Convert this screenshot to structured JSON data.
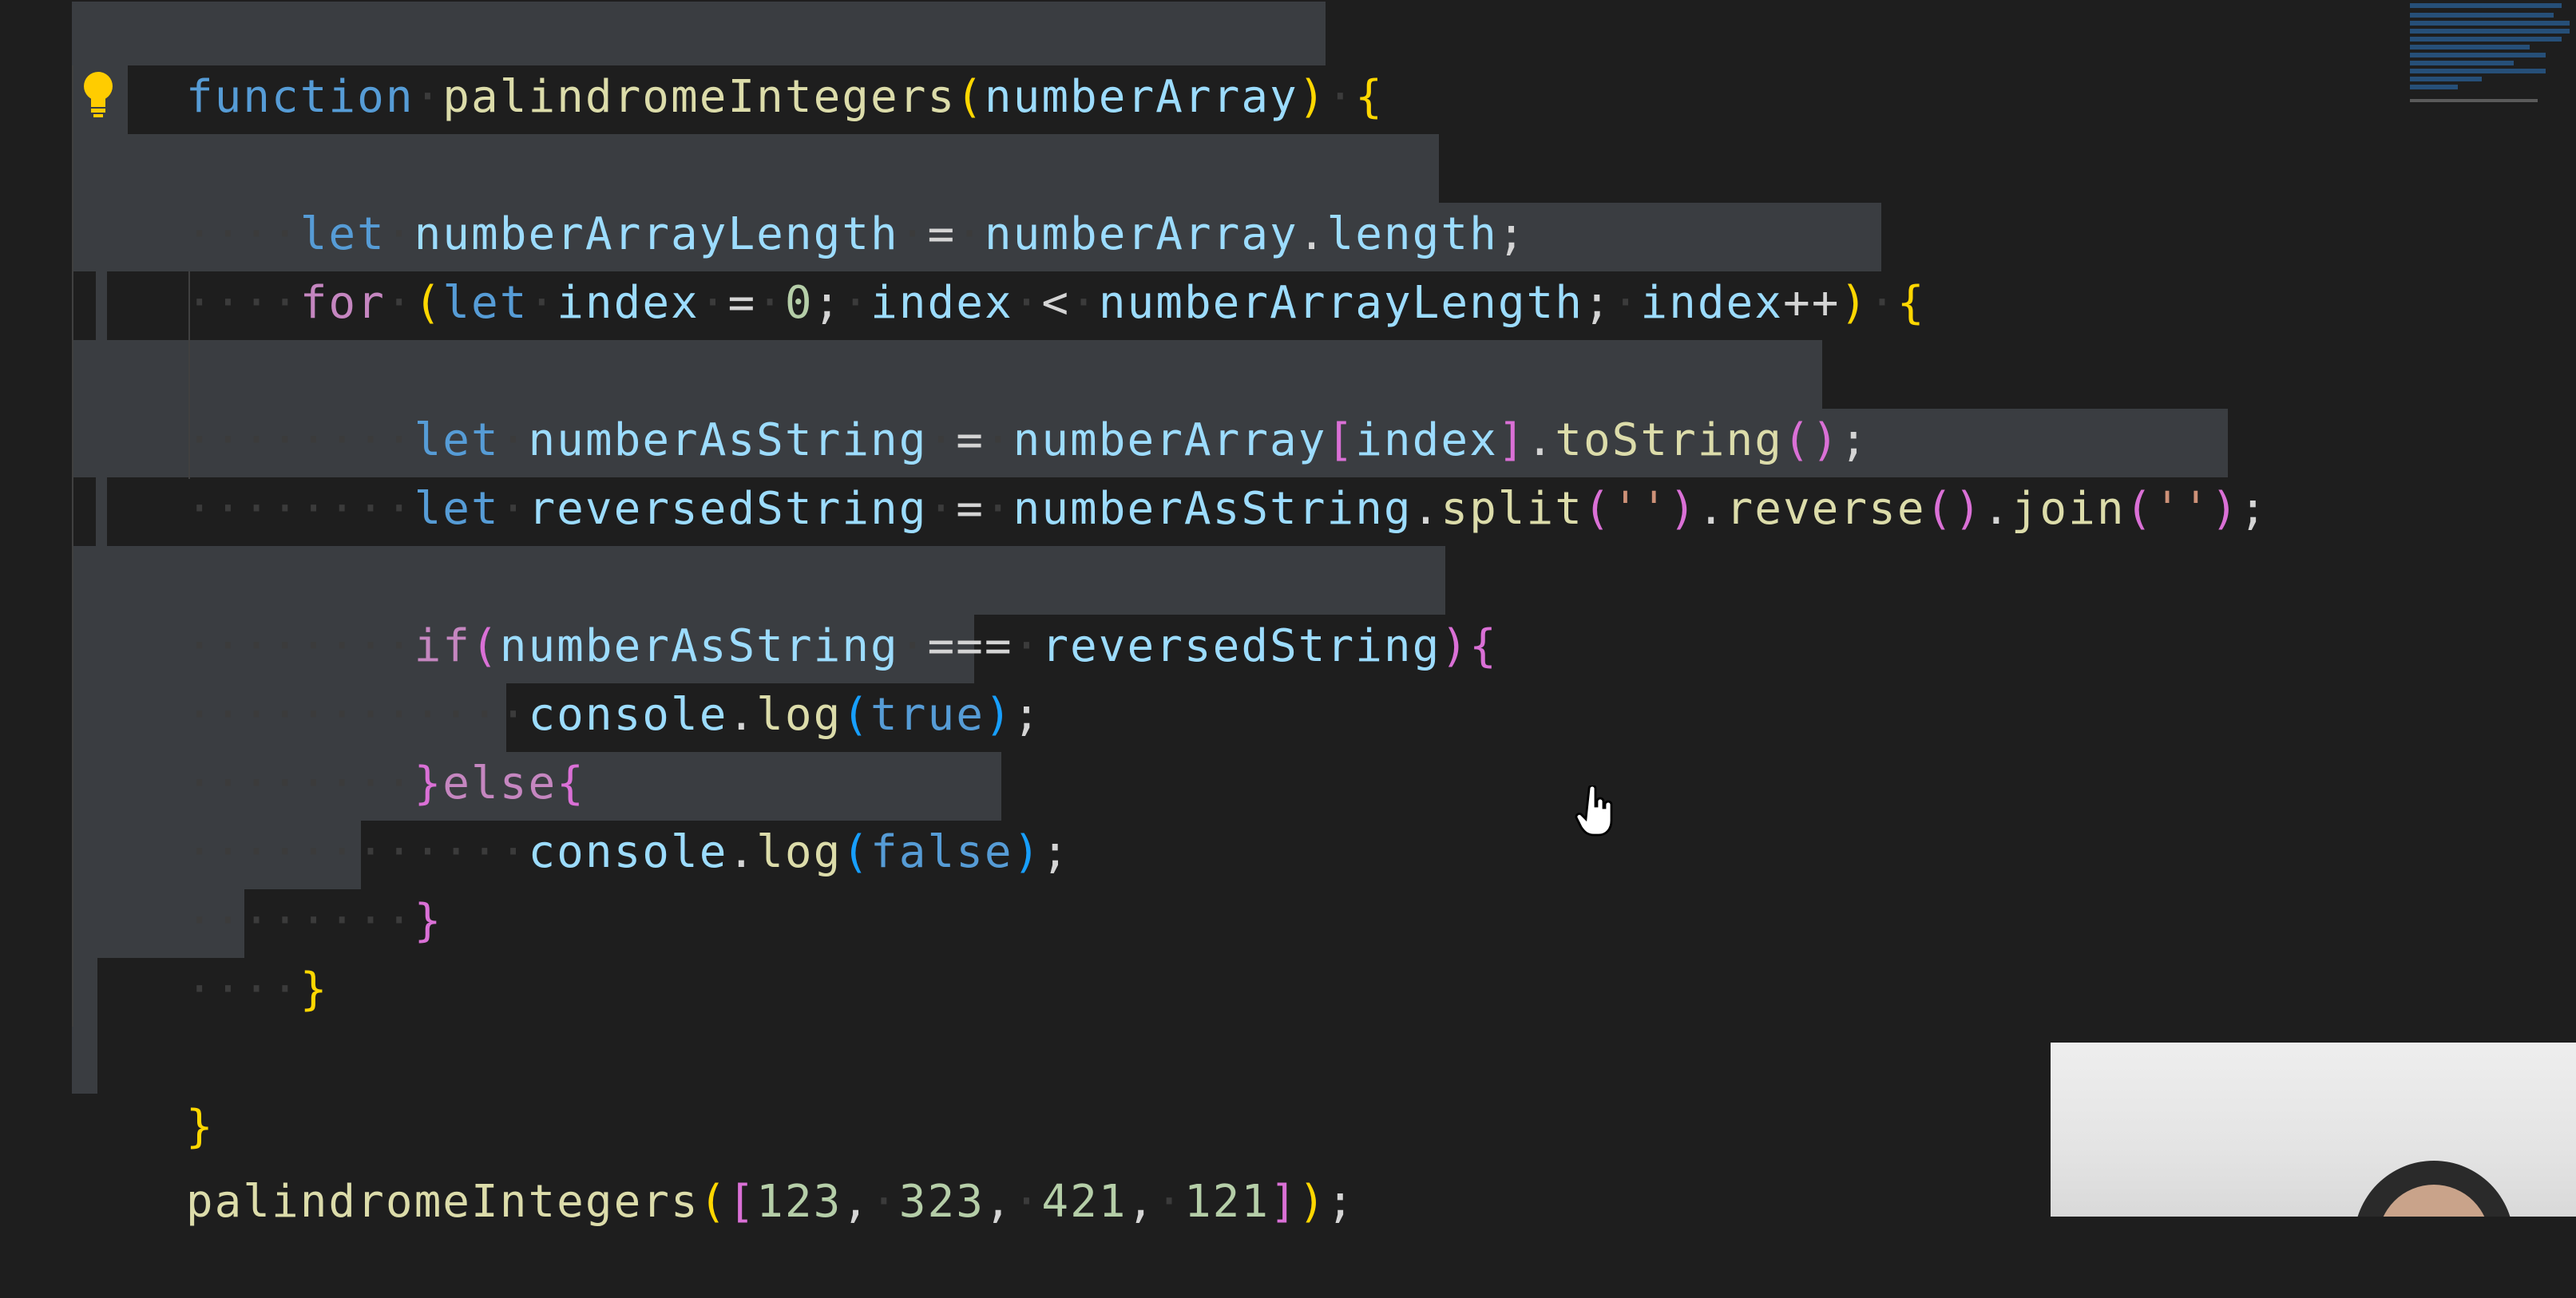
{
  "editor": {
    "lines": {
      "l1": {
        "kw": "function",
        "fn": "palindromeIntegers",
        "open": "(",
        "param": "numberArray",
        "close": ")",
        "brace": "{"
      },
      "l3": {
        "kw": "let",
        "var": "numberArrayLength",
        "eq": "=",
        "obj": "numberArray",
        "dot": ".",
        "prop": "length",
        "semi": ";"
      },
      "l4": {
        "kw": "for",
        "p1": "(",
        "kw2": "let",
        "v1": "index",
        "eq": "=",
        "n0": "0",
        "s1": ";",
        "v2": "index",
        "lt": "<",
        "v3": "numberArrayLength",
        "s2": ";",
        "v4": "index",
        "inc": "++",
        "p2": ")",
        "brace": "{"
      },
      "l6": {
        "kw": "let",
        "var": "numberAsString",
        "eq": "=",
        "obj": "numberArray",
        "bo": "[",
        "idx": "index",
        "bc": "]",
        "dot": ".",
        "fn": "toString",
        "call": "()",
        "semi": ";"
      },
      "l7": {
        "kw": "let",
        "var": "reversedString",
        "eq": "=",
        "obj": "numberAsString",
        "dot1": ".",
        "fn1": "split",
        "po1": "(",
        "q1": "''",
        "pc1": ")",
        "dot2": ".",
        "fn2": "reverse",
        "call2": "()",
        "dot3": ".",
        "fn3": "join",
        "po3": "(",
        "q3": "''",
        "pc3": ")",
        "semi": ";"
      },
      "l9": {
        "kw": "if",
        "po": "(",
        "a": "numberAsString",
        "op": "===",
        "b": "reversedString",
        "pc": ")",
        "brace": "{"
      },
      "l10": {
        "obj": "console",
        "dot": ".",
        "fn": "log",
        "po": "(",
        "val": "true",
        "pc": ")",
        "semi": ";"
      },
      "l11": {
        "close": "}",
        "kw": "else",
        "open": "{"
      },
      "l12": {
        "obj": "console",
        "dot": ".",
        "fn": "log",
        "po": "(",
        "val": "false",
        "pc": ")",
        "semi": ";"
      },
      "l13": {
        "close": "}"
      },
      "l14": {
        "close": "}"
      },
      "l16": {
        "close": "}"
      },
      "l17": {
        "fn": "palindromeIntegers",
        "po": "(",
        "bo": "[",
        "n1": "123",
        "c1": ",",
        "n2": "323",
        "c2": ",",
        "n3": "421",
        "c3": ",",
        "n4": "121",
        "bc": "]",
        "pc": ")",
        "semi": ";"
      }
    }
  },
  "icons": {
    "lightbulb": "lightbulb-icon",
    "cursor": "hand-cursor-icon"
  },
  "colors": {
    "background": "#1e1e1e",
    "selection": "#3a3d41",
    "keyword": "#569cd6",
    "control": "#c586c0",
    "function": "#dcdcaa",
    "variable": "#9cdcfe",
    "number": "#b5cea8",
    "string": "#ce9178",
    "bracket1": "#ffd700",
    "bracket2": "#da70d6",
    "bracket3": "#179fff"
  }
}
